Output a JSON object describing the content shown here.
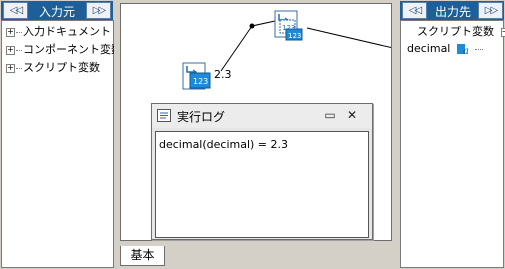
{
  "input_panel": {
    "title": "入力元",
    "prev_label": "◁◁",
    "next_label": "▷▷",
    "tree": [
      {
        "label": "入力ドキュメント",
        "expander": "+"
      },
      {
        "label": "コンポーネント変数",
        "expander": "+"
      },
      {
        "label": "スクリプト変数",
        "expander": "+"
      }
    ]
  },
  "output_panel": {
    "title": "出力先",
    "prev_label": "◁◁",
    "next_label": "▷▷",
    "tree_root": {
      "label": "スクリプト変数",
      "expander": "−"
    },
    "item": {
      "label": "decimal"
    }
  },
  "canvas": {
    "source_value_label": "2.3",
    "tab_label": "基本"
  },
  "log_window": {
    "title": "実行ログ",
    "restore_glyph": "▭",
    "close_glyph": "✕",
    "lines": [
      "decimal(decimal) = 2.3"
    ]
  },
  "colors": {
    "header_blue": "#1c5f9a",
    "icon_blue": "#1f8ad6",
    "panel_gray": "#d4d0c8"
  }
}
